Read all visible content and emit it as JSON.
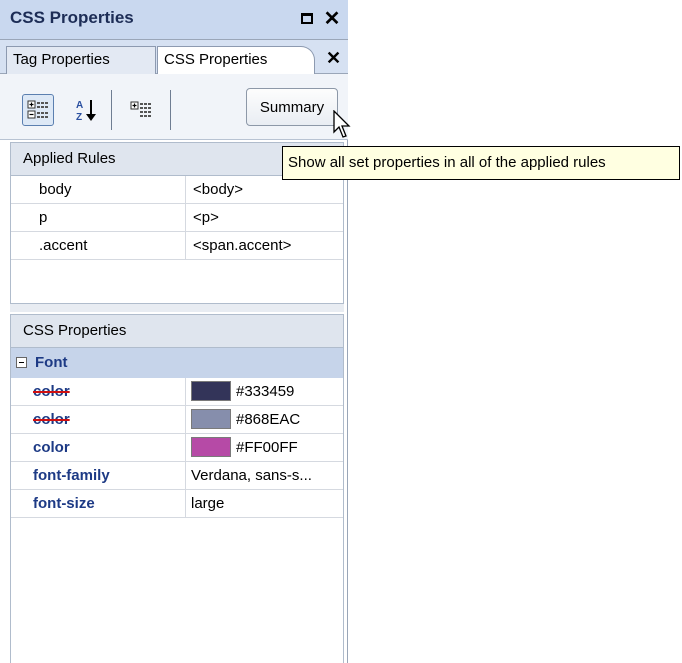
{
  "window": {
    "title": "CSS Properties"
  },
  "tabs": [
    {
      "label": "Tag Properties"
    },
    {
      "label": "CSS Properties"
    }
  ],
  "toolbar": {
    "summary_label": "Summary",
    "icons": [
      "categorized-list-icon",
      "sort-az-icon",
      "show-set-properties-icon"
    ]
  },
  "tooltip": {
    "text": "Show all set properties in all of the applied rules"
  },
  "applied_rules": {
    "header": "Applied Rules",
    "rows": [
      {
        "rule": "body",
        "tag": "<body>"
      },
      {
        "rule": "p",
        "tag": "<p>"
      },
      {
        "rule": ".accent",
        "tag": "<span.accent>"
      }
    ]
  },
  "css_properties": {
    "header": "CSS Properties",
    "category": "Font",
    "rows": [
      {
        "name": "color",
        "value": "#333459",
        "swatch": "#333459",
        "overridden": true
      },
      {
        "name": "color",
        "value": "#868EAC",
        "swatch": "#868EAC",
        "overridden": true
      },
      {
        "name": "color",
        "value": "#FF00FF",
        "swatch": "#B64AA6",
        "overridden": false
      },
      {
        "name": "font-family",
        "value": "Verdana, sans-s...",
        "overridden": false
      },
      {
        "name": "font-size",
        "value": "large",
        "overridden": false
      }
    ]
  }
}
